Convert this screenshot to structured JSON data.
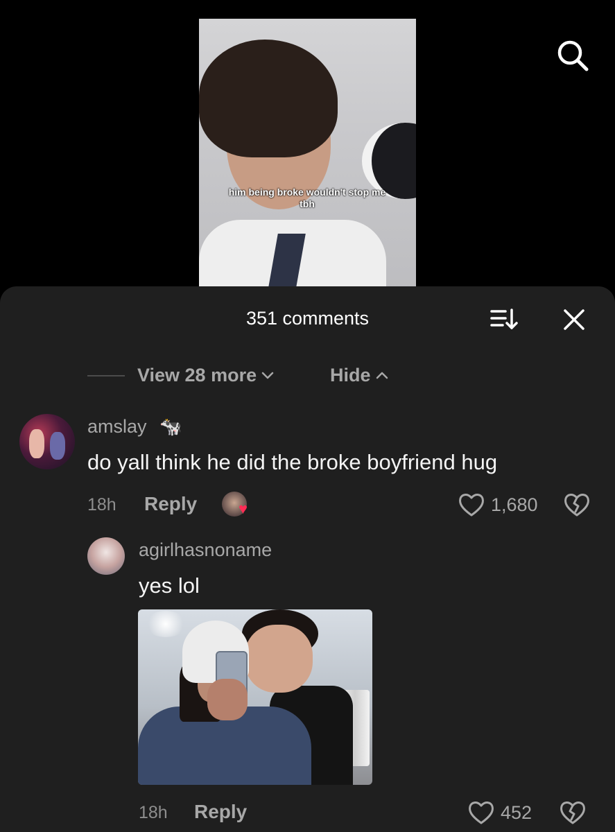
{
  "video": {
    "caption": "him being broke wouldn't stop me tbh"
  },
  "comments_sheet": {
    "title": "351 comments",
    "thread_controls": {
      "view_more_label": "View 28 more",
      "hide_label": "Hide"
    },
    "comments": [
      {
        "username": "amslay",
        "username_emoji": "🐄",
        "text": "do yall think he did the broke boyfriend hug",
        "time": "18h",
        "reply_label": "Reply",
        "like_count": "1,680",
        "liked_by_creator": true
      },
      {
        "username": "agirlhasnoname",
        "text": "yes lol",
        "time": "18h",
        "reply_label": "Reply",
        "like_count": "452",
        "has_photo": true
      }
    ]
  },
  "colors": {
    "sheet_bg": "#1f1f1f",
    "muted_text": "#a8a8a8",
    "accent_heart": "#fe2c55"
  }
}
